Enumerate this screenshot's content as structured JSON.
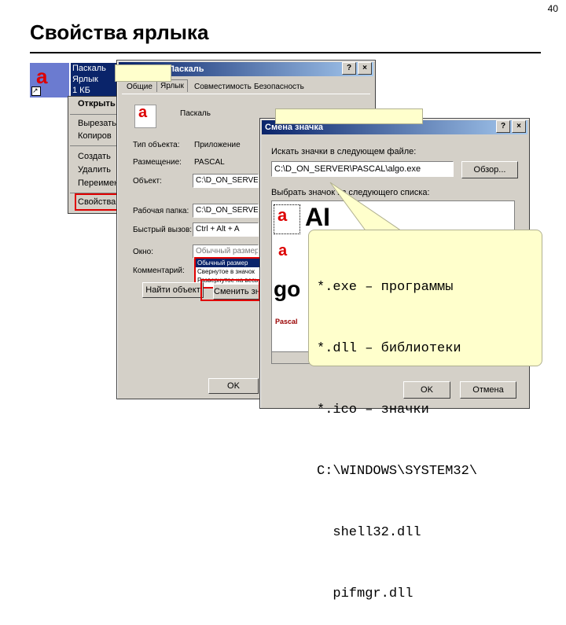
{
  "page_number": "40",
  "slide_title": "Свойства ярлыка",
  "desktop_icon": {
    "label_lines": [
      "Паскаль",
      "Ярлык",
      "1 КБ"
    ]
  },
  "context_menu": {
    "items": [
      "Открыть",
      "Вырезать",
      "Копиров",
      "Создать",
      "Удалить",
      "Переимен",
      "Свойства"
    ]
  },
  "properties_dialog": {
    "title": "Свойства: Паскаль",
    "tabs": [
      "Общие",
      "Ярлык",
      "Совместимость",
      "Безопасность"
    ],
    "name_value": "Паскаль",
    "rows": [
      {
        "label": "Тип объекта:",
        "value": "Приложение"
      },
      {
        "label": "Размещение:",
        "value": "PASCAL"
      },
      {
        "label": "Объект:",
        "value": "C:\\D_ON_SERVER"
      },
      {
        "label": "Рабочая папка:",
        "value": "C:\\D_ON_SERVER"
      },
      {
        "label": "Быстрый вызов:",
        "value": "Ctrl + Alt + A"
      },
      {
        "label": "Окно:",
        "value": "Обычный размер"
      },
      {
        "label": "Комментарий:",
        "value": ""
      }
    ],
    "dropdown_options": [
      "Обычный размер",
      "Свернутое в значок",
      "Развернутое на весь"
    ],
    "find_button": "Найти объект",
    "change_icon_button": "Сменить значок",
    "ok_button": "OK"
  },
  "change_icon_dialog": {
    "title": "Смена значка",
    "search_label": "Искать значки в следующем файле:",
    "file_path": "C:\\D_ON_SERVER\\PASCAL\\algo.exe",
    "browse_button": "Обзор...",
    "select_label": "Выбрать значок из следующего списка:",
    "ok_button": "OK",
    "cancel_button": "Отмена"
  },
  "callout_lines": [
    "*.exe – программы",
    "*.dll – библиотеки",
    "*.ico – значки",
    "C:\\WINDOWS\\SYSTEM32\\",
    "  shell32.dll",
    "  pifmgr.dll"
  ],
  "colors": {
    "titlebar": "#0a246a",
    "highlight_red": "#e00000",
    "callout_fill": "#ffffcc",
    "face": "#d4d0c8"
  }
}
